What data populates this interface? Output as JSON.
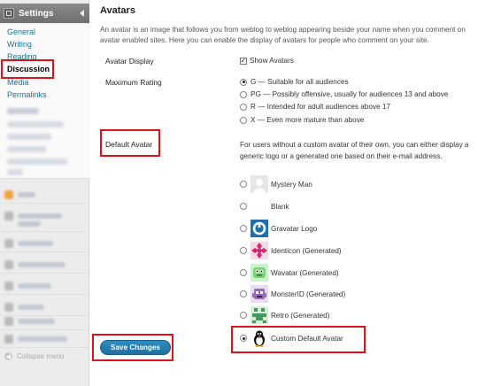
{
  "sidebar": {
    "settings_label": "Settings",
    "items": [
      {
        "label": "General"
      },
      {
        "label": "Writing"
      },
      {
        "label": "Reading"
      },
      {
        "label": "Discussion",
        "current": true
      },
      {
        "label": "Media"
      },
      {
        "label": "Permalinks"
      }
    ],
    "collapse_label": "Collapse menu"
  },
  "main": {
    "title": "Avatars",
    "description": "An avatar is an image that follows you from weblog to weblog appearing beside your name when you comment on avatar enabled sites. Here you can enable the display of avatars for people who comment on your site.",
    "avatar_display": {
      "label": "Avatar Display",
      "checkbox_label": "Show Avatars",
      "checked": true
    },
    "max_rating": {
      "label": "Maximum Rating",
      "options": [
        {
          "label": "G — Suitable for all audiences",
          "selected": true
        },
        {
          "label": "PG — Possibly offensive, usually for audiences 13 and above",
          "selected": false
        },
        {
          "label": "R — Intended for adult audiences above 17",
          "selected": false
        },
        {
          "label": "X — Even more mature than above",
          "selected": false
        }
      ]
    },
    "default_avatar": {
      "label": "Default Avatar",
      "help": "For users without a custom avatar of their own, you can either display a generic logo or a generated one based on their e-mail address.",
      "options": [
        {
          "label": "Mystery Man",
          "icon": "mystery-man-icon",
          "selected": false
        },
        {
          "label": "Blank",
          "icon": "blank-icon",
          "selected": false
        },
        {
          "label": "Gravatar Logo",
          "icon": "gravatar-logo-icon",
          "selected": false
        },
        {
          "label": "Identicon (Generated)",
          "icon": "identicon-icon",
          "selected": false
        },
        {
          "label": "Wavatar (Generated)",
          "icon": "wavatar-icon",
          "selected": false
        },
        {
          "label": "MonsterID (Generated)",
          "icon": "monsterid-icon",
          "selected": false
        },
        {
          "label": "Retro (Generated)",
          "icon": "retro-icon",
          "selected": false
        },
        {
          "label": "Custom Default Avatar",
          "icon": "penguin-icon",
          "selected": true
        }
      ]
    },
    "save_label": "Save Changes"
  },
  "colors": {
    "highlight": "#e0101c",
    "link": "#21759b",
    "button": "#2e8ec1"
  }
}
